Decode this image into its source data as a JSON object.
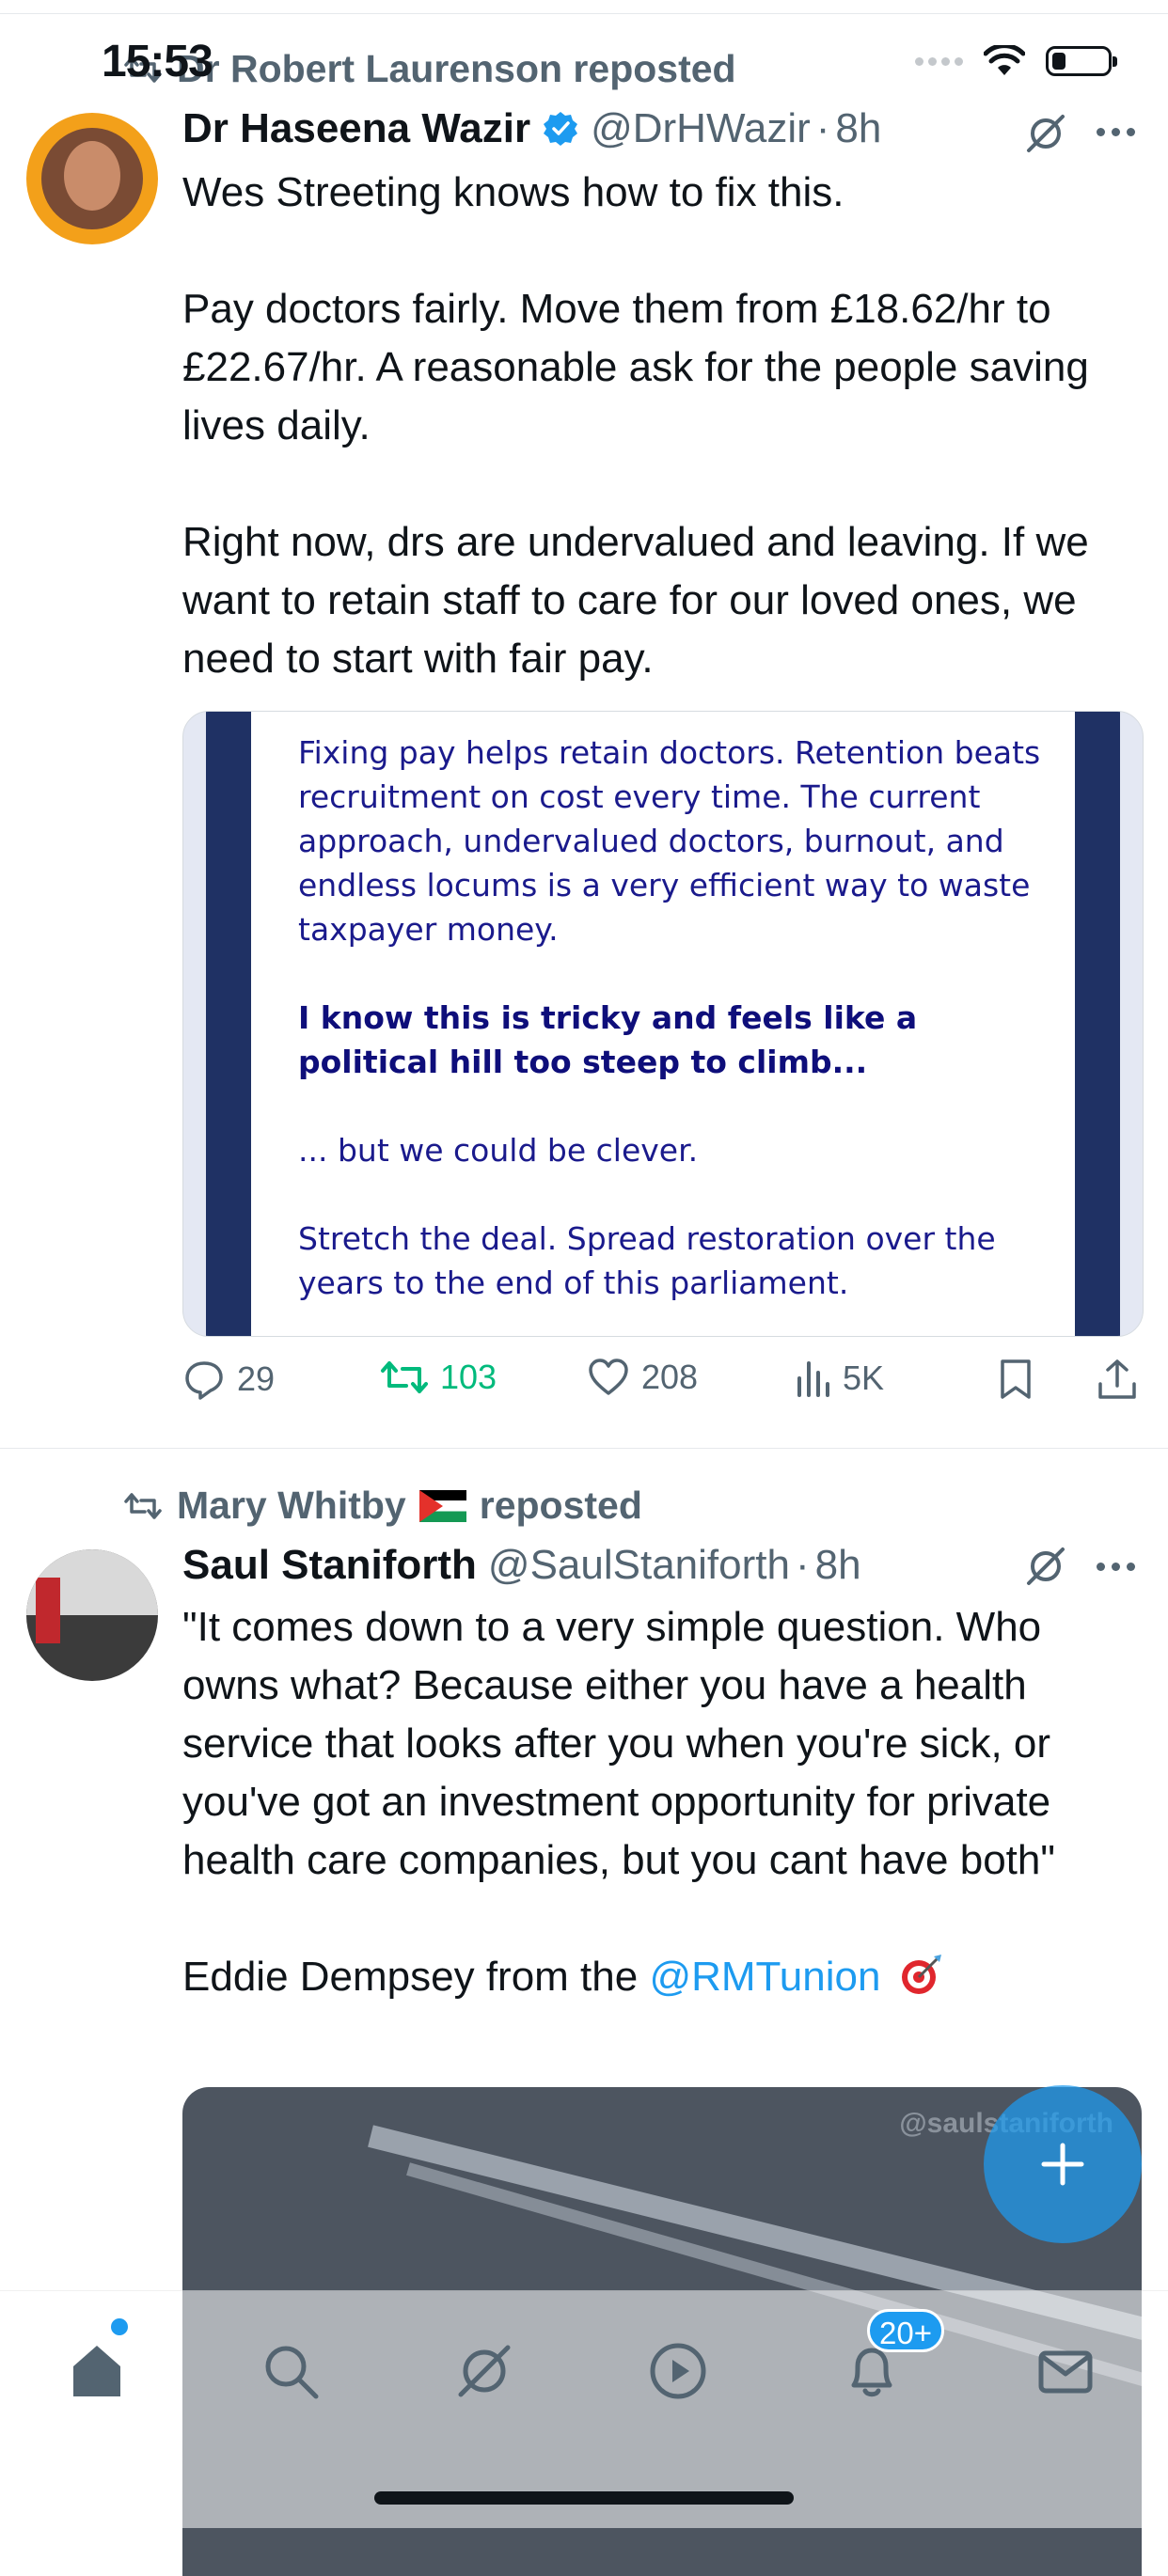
{
  "status_bar": {
    "time": "15:53"
  },
  "tweets": [
    {
      "reposted_by": "Dr Robert Laurenson reposted",
      "author_name": "Dr Haseena Wazir",
      "handle": "@DrHWazir",
      "time": "8h",
      "verified": true,
      "text": [
        "Wes Streeting knows how to fix this.",
        "",
        "Pay doctors fairly. Move them from £18.62/hr to £22.67/hr. A reasonable ask for the people saving lives daily.",
        "",
        "Right now, drs are undervalued and leaving. If we want to retain staff to care for our loved ones, we need to start with fair pay."
      ],
      "card": {
        "para1": "Fixing pay helps retain doctors. Retention beats recruitment on cost every time. The current approach, undervalued doctors, burnout, and endless locums is a very efficient way to waste taxpayer money.",
        "para2_bold": "I know this is tricky and feels like a political hill too steep to climb...",
        "para3": "... but we could be clever.",
        "para4": "Stretch the deal. Spread restoration over the years to the end of this parliament."
      },
      "stats": {
        "replies": "29",
        "reposts": "103",
        "likes": "208",
        "views": "5K"
      }
    },
    {
      "reposted_by_name": "Mary Whitby",
      "reposted_suffix": "reposted",
      "author_name": "Saul Staniforth",
      "handle": "@SaulStaniforth",
      "time": "8h",
      "text": [
        "\"It comes down to a very simple question. Who owns what? Because either you have a health service that looks after you when you're sick, or you've got an  investment opportunity for private health care companies, but you cant have both\"",
        ""
      ],
      "text_tail_prefix": "Eddie Dempsey from the ",
      "text_tail_mention": "@RMTunion",
      "video_watermark": "@saulstaniforth"
    }
  ],
  "tab_bar": {
    "notifications_badge": "20+"
  },
  "colors": {
    "accent": "#1d9bf0",
    "repost_green": "#00ba7c",
    "secondary_text": "#536471"
  }
}
